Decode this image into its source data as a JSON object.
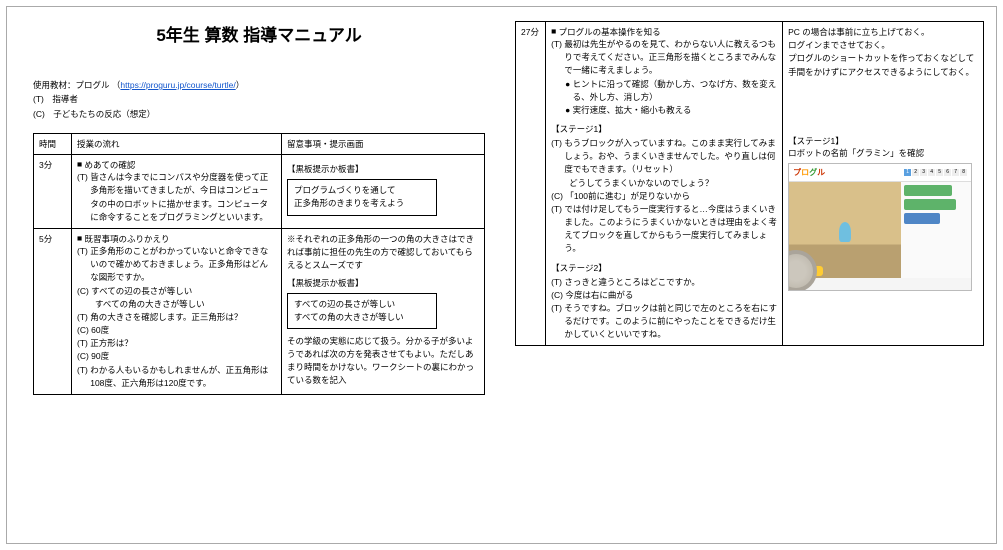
{
  "title": "5年生 算数 指導マニュアル",
  "materials_label": "使用教材：プログル",
  "materials_url": "https://proguru.jp/course/turtle/",
  "role_t": "(T)　指導者",
  "role_c": "(C)　子どもたちの反応（想定）",
  "headers": {
    "time": "時間",
    "flow": "授業の流れ",
    "notes": "留意事項・提示画面"
  },
  "rows1": [
    {
      "time": "3分",
      "heading": "めあての確認",
      "flow": [
        {
          "cls": "t",
          "txt": "皆さんは今までにコンパスや分度器を使って正多角形を描いてきましたが、今日はコンピュータの中のロボットに描かせます。コンピュータに命令することをプログラミングといいます。"
        }
      ],
      "notes": {
        "label": "【黒板提示か板書】",
        "box": [
          "プログラムづくりを通して",
          "正多角形のきまりを考えよう"
        ]
      }
    },
    {
      "time": "5分",
      "heading": "既習事項のふりかえり",
      "flow": [
        {
          "cls": "t",
          "txt": "正多角形のことがわかっていないと命令できないので確かめておきましょう。正多角形はどんな図形ですか。"
        },
        {
          "cls": "c",
          "txt": "すべての辺の長さが等しい"
        },
        {
          "cls": "indent",
          "txt": "すべての角の大きさが等しい"
        },
        {
          "cls": "t",
          "txt": "角の大きさを確認します。正三角形は？"
        },
        {
          "cls": "c",
          "txt": "60度"
        },
        {
          "cls": "t",
          "txt": "正方形は？"
        },
        {
          "cls": "c",
          "txt": "90度"
        },
        {
          "cls": "t",
          "txt": "わかる人もいるかもしれませんが、正五角形は108度、正六角形は120度です。"
        }
      ],
      "notes": {
        "pre": "※それぞれの正多角形の一つの角の大きさはできれば事前に担任の先生の方で確認しておいてもらえるとスムーズです",
        "label": "【黒板提示か板書】",
        "box": [
          "すべての辺の長さが等しい",
          "すべての角の大きさが等しい"
        ],
        "post": "その学級の実態に応じて扱う。分かる子が多いようであれば次の方を発表させてもよい。ただしあまり時間をかけない。ワークシートの裏にわかっている数を記入"
      }
    }
  ],
  "row2": {
    "time": "27分",
    "heading": "プログルの基本操作を知る",
    "flow_top": [
      {
        "cls": "t",
        "txt": "最初は先生がやるのを見て、わからない人に教えるつもりで考えてください。正三角形を描くところまでみんなで一緒に考えましょう。"
      },
      {
        "cls": "bullet",
        "txt": "ヒントに沿って確認（動かし方、つなげ方、数を変える、外し方、消し方）"
      },
      {
        "cls": "bullet",
        "txt": "実行速度、拡大・縮小も教える"
      }
    ],
    "stage1_label": "【ステージ1】",
    "stage1": [
      {
        "cls": "t",
        "txt": "もうブロックが入っていますね。このまま実行してみましょう。おや、うまくいきませんでした。やり直しは何度でもできます。（リセット）"
      },
      {
        "cls": "indent",
        "txt": "どうしてうまくいかないのでしょう？"
      },
      {
        "cls": "c",
        "txt": "「100前に進む」が足りないから"
      },
      {
        "cls": "t",
        "txt": "では付け足してもう一度実行すると…今度はうまくいきました。このようにうまくいかないときは理由をよく考えてブロックを直してからもう一度実行してみましょう。"
      }
    ],
    "stage2_label": "【ステージ2】",
    "stage2": [
      {
        "cls": "t",
        "txt": "さっきと違うところはどこですか。"
      },
      {
        "cls": "c",
        "txt": "今度は右に曲がる"
      },
      {
        "cls": "t",
        "txt": "そうですね。ブロックは前と同じで左のところを右にするだけです。このように前にやったことをできるだけ生かしていくといいですね。"
      }
    ],
    "right_top": [
      "PC の場合は事前に立ち上げておく。",
      "ログインまでさせておく。",
      "プログルのショートカットを作っておくなどして手間をかけずにアクセスできるようにしておく。"
    ],
    "right_stage1_label": "【ステージ1】",
    "right_stage1_caption": "ロボットの名前「グラミン」を確認"
  }
}
